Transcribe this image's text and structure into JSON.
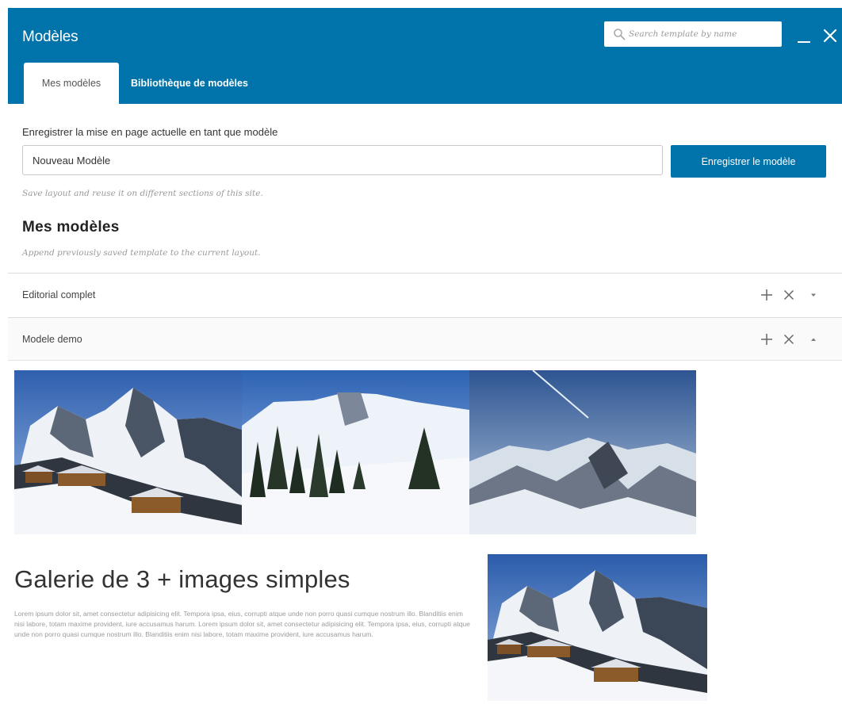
{
  "window": {
    "title": "Modèles",
    "search_placeholder": "Search template by name"
  },
  "tabs": [
    {
      "label": "Mes modèles",
      "active": true
    },
    {
      "label": "Bibliothèque de modèles",
      "active": false
    }
  ],
  "save_section": {
    "label": "Enregistrer la mise en page actuelle en tant que modèle",
    "input_value": "Nouveau Modèle",
    "button_label": "Enregistrer le modèle",
    "help": "Save layout and reuse it on different sections of this site."
  },
  "my_templates": {
    "title": "Mes modèles",
    "help": "Append previously saved template to the current layout."
  },
  "templates": [
    {
      "name": "Editorial complet",
      "expanded": false
    },
    {
      "name": "Modele demo",
      "expanded": true
    }
  ],
  "preview": {
    "heading": "Galerie de 3 + images simples",
    "body": "Lorem ipsum dolor sit, amet consectetur adipisicing elit. Tempora ipsa, eius, corrupti atque unde non porro quasi cumque nostrum illo. Blanditiis enim nisi labore, totam maxime provident, iure accusamus harum. Lorem ipsum dolor sit, amet consectetur adipisicing elit. Tempora ipsa, eius, corrupti atque unde non porro quasi cumque nostrum illo. Blanditiis enim nisi labore, totam maxime provident, iure accusamus harum."
  },
  "colors": {
    "accent": "#0073aa",
    "header_text": "#ffffff",
    "muted_text": "#9a9a9a"
  },
  "icons": {
    "search": "search-icon",
    "minimize": "minimize-icon",
    "close": "close-icon",
    "add": "plus-icon",
    "remove": "x-icon",
    "collapsed": "caret-down-icon",
    "expanded": "caret-up-icon"
  }
}
